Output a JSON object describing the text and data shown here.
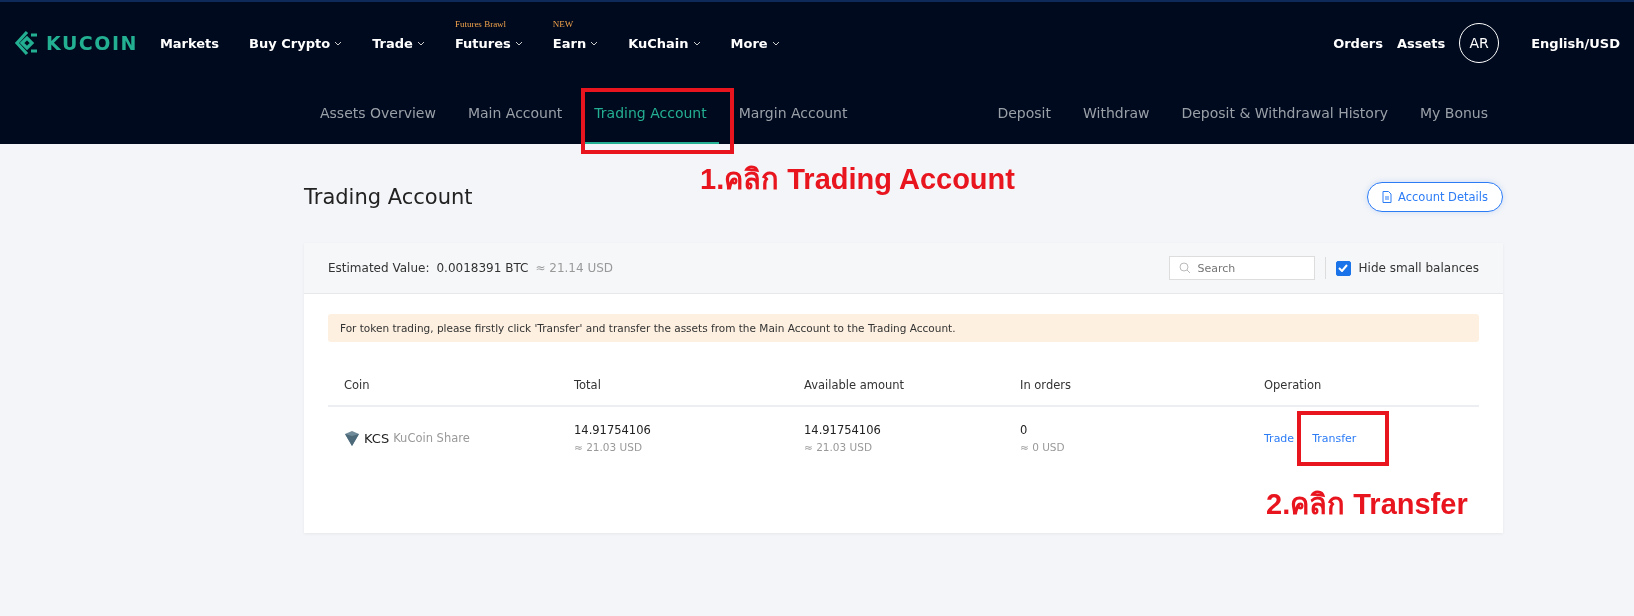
{
  "header": {
    "logo": "KUCOIN",
    "nav": [
      {
        "label": "Markets",
        "dropdown": false
      },
      {
        "label": "Buy Crypto",
        "dropdown": true
      },
      {
        "label": "Trade",
        "dropdown": true
      },
      {
        "label": "Futures",
        "dropdown": true,
        "badge": "Futures Brawl"
      },
      {
        "label": "Earn",
        "dropdown": true,
        "badge": "NEW"
      },
      {
        "label": "KuChain",
        "dropdown": true
      },
      {
        "label": "More",
        "dropdown": true
      }
    ],
    "right_links": [
      "Orders",
      "Assets"
    ],
    "avatar": "AR",
    "language": "English/USD"
  },
  "subnav": {
    "tabs": [
      {
        "label": "Assets Overview",
        "selected": false
      },
      {
        "label": "Main Account",
        "selected": false
      },
      {
        "label": "Trading Account",
        "selected": true
      },
      {
        "label": "Margin Account",
        "selected": false
      }
    ],
    "links": [
      "Deposit",
      "Withdraw",
      "Deposit & Withdrawal History",
      "My Bonus"
    ]
  },
  "page": {
    "title": "Trading Account",
    "details_button": "Account Details"
  },
  "summary": {
    "label": "Estimated Value:",
    "value": "0.0018391 BTC",
    "approx": "≈ 21.14 USD",
    "search": {
      "placeholder": "Search"
    },
    "hide_small": {
      "label": "Hide small balances",
      "checked": true
    }
  },
  "notice": "For token trading, please firstly click 'Transfer' and transfer the assets from the Main Account to the Trading Account.",
  "table": {
    "columns": [
      "Coin",
      "Total",
      "Available amount",
      "In orders",
      "Operation"
    ],
    "rows": [
      {
        "coin": "KCS",
        "coin_name": "KuCoin Share",
        "total": "14.91754106",
        "total_usd": "≈ 21.03 USD",
        "available": "14.91754106",
        "available_usd": "≈ 21.03 USD",
        "in_orders": "0",
        "in_orders_usd": "≈ 0 USD",
        "actions": [
          "Trade",
          "Transfer"
        ]
      }
    ]
  },
  "annotations": [
    {
      "text": "1.คลิก Trading Account"
    },
    {
      "text": "2.คลิก Transfer"
    }
  ]
}
